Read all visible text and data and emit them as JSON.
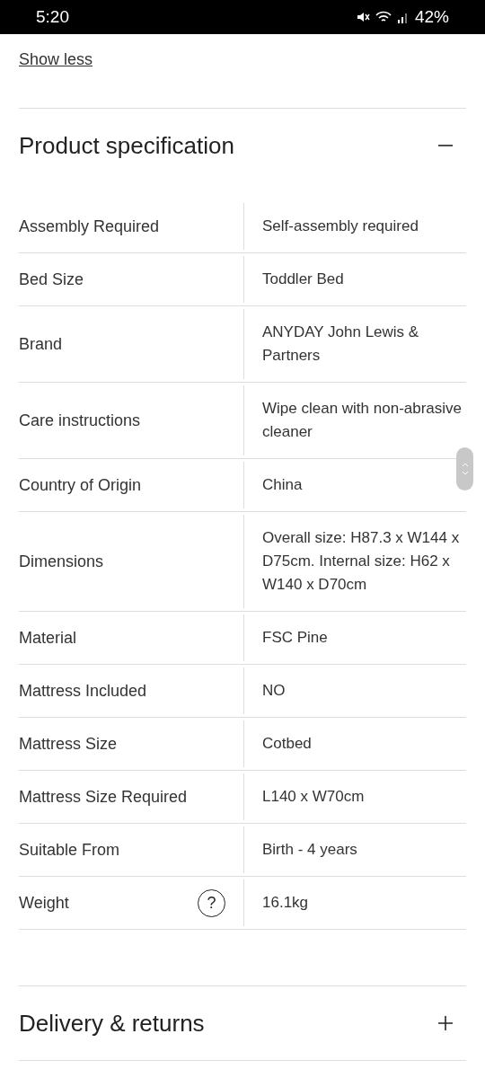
{
  "status_bar": {
    "time": "5:20",
    "battery": "42%"
  },
  "show_less": "Show less",
  "sections": [
    {
      "title": "Product specification",
      "expanded": true,
      "rows": [
        {
          "label": "Assembly Required",
          "value": "Self-assembly required"
        },
        {
          "label": "Bed Size",
          "value": "Toddler Bed"
        },
        {
          "label": "Brand",
          "value": "ANYDAY John Lewis & Partners"
        },
        {
          "label": "Care instructions",
          "value": "Wipe clean with non-abrasive cleaner"
        },
        {
          "label": "Country of Origin",
          "value": "China"
        },
        {
          "label": "Dimensions",
          "value": "Overall size: H87.3 x W144 x D75cm. Internal size: H62 x W140 x D70cm"
        },
        {
          "label": "Material",
          "value": "FSC Pine"
        },
        {
          "label": "Mattress Included",
          "value": "NO"
        },
        {
          "label": "Mattress Size",
          "value": "Cotbed"
        },
        {
          "label": "Mattress Size Required",
          "value": "L140 x W70cm"
        },
        {
          "label": "Suitable From",
          "value": "Birth - 4 years"
        },
        {
          "label": "Weight",
          "value": "16.1kg",
          "help": "?"
        }
      ]
    },
    {
      "title": "Delivery & returns",
      "expanded": false
    }
  ]
}
